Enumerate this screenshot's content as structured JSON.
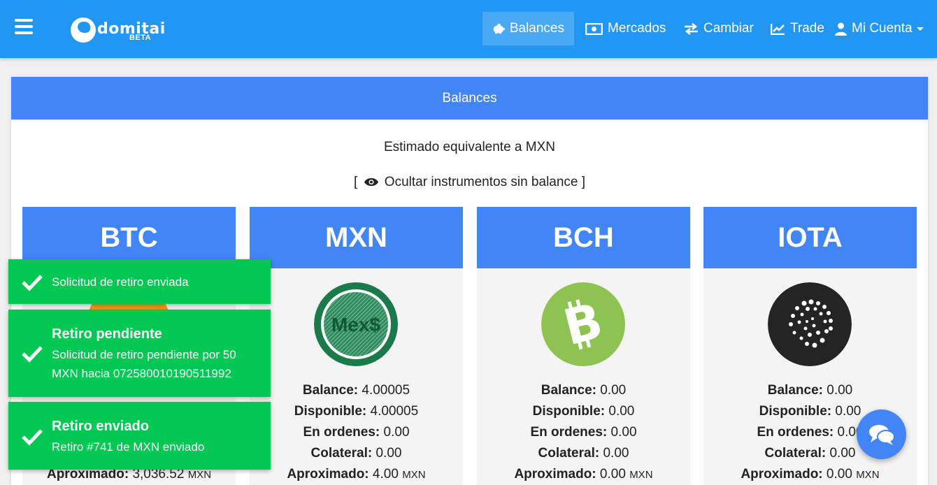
{
  "navbar": {
    "logo_text": "domitai",
    "logo_beta": "BETA",
    "items": [
      {
        "label": "Balances",
        "icon": "piggy-bank-icon",
        "active": true
      },
      {
        "label": "Mercados",
        "icon": "money-bill-icon"
      },
      {
        "label": "Cambiar",
        "icon": "exchange-icon"
      },
      {
        "label": "Trade",
        "icon": "chart-line-icon"
      },
      {
        "label": "Mi Cuenta",
        "icon": "user-icon"
      }
    ]
  },
  "panel": {
    "title": "Balances",
    "subtitle": "Estimado equivalente a MXN",
    "toggle_label": "Ocultar instrumentos sin balance",
    "toggle_open": "[",
    "toggle_close": "]"
  },
  "labels": {
    "balance": "Balance:",
    "available": "Disponible:",
    "orders": "En ordenes:",
    "collateral": "Colateral:",
    "approx": "Aproximado:",
    "currency": "MXN"
  },
  "cards": [
    {
      "symbol": "BTC",
      "balance": "",
      "available": "",
      "orders": "",
      "collateral": "",
      "approx": "3,036.52",
      "coin_color": "#f7931a"
    },
    {
      "symbol": "MXN",
      "balance": "4.00005",
      "available": "4.00005",
      "orders": "0.00",
      "collateral": "0.00",
      "approx": "4.00",
      "coin_color": "#1b7a4a",
      "coin_text": "Mex$"
    },
    {
      "symbol": "BCH",
      "balance": "0.00",
      "available": "0.00",
      "orders": "0.00",
      "collateral": "0.00",
      "approx": "0.00",
      "coin_color": "#8dc351"
    },
    {
      "symbol": "IOTA",
      "balance": "0.00",
      "available": "0.00",
      "orders": "0.00",
      "collateral": "0.00",
      "approx": "0.00",
      "coin_color": "#242424"
    }
  ],
  "toasts": [
    {
      "title": "",
      "message": "Solicitud de retiro enviada"
    },
    {
      "title": "Retiro pendiente",
      "message": "Solicitud de retiro pendiente por 50 MXN hacia 072580010190511992"
    },
    {
      "title": "Retiro enviado",
      "message": "Retiro #741 de MXN enviado"
    }
  ],
  "colors": {
    "primary": "#2196f3",
    "panel_header": "#4285f4",
    "toast_success": "#00c853"
  }
}
